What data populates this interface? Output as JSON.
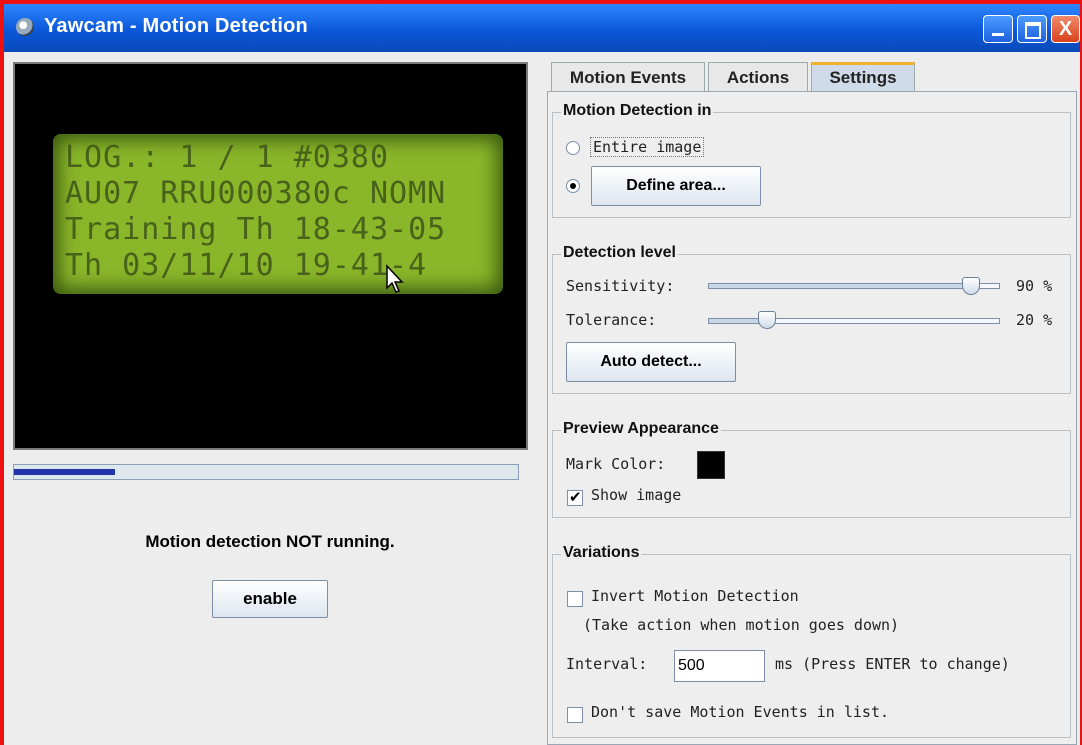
{
  "window": {
    "title": "Yawcam - Motion Detection",
    "close_glyph": "X"
  },
  "preview": {
    "lcd_lines": [
      "LOG.:   1 / 1    #0380",
      "AU07 RRU000380c NOMN",
      "Training Th 18-43-05",
      "Th 03/11/10 19-41-4"
    ]
  },
  "progress": {
    "value": 0.2
  },
  "left": {
    "status": "Motion detection NOT running.",
    "enable_label": "enable"
  },
  "tabs": [
    {
      "label": "Motion Events"
    },
    {
      "label": "Actions"
    },
    {
      "label": "Settings"
    }
  ],
  "settings": {
    "motion_detection_in": {
      "title": "Motion Detection in",
      "entire_image": "Entire image",
      "define_area": "Define area...",
      "selected": "define_area"
    },
    "detection_level": {
      "title": "Detection level",
      "sensitivity_label": "Sensitivity:",
      "sensitivity_value": 90,
      "sensitivity_text": "90 %",
      "tolerance_label": "Tolerance:",
      "tolerance_value": 20,
      "tolerance_text": "20 %",
      "auto_detect": "Auto detect..."
    },
    "preview_appearance": {
      "title": "Preview Appearance",
      "mark_color_label": "Mark Color:",
      "mark_color": "#000000",
      "show_image_label": "Show image",
      "show_image": true
    },
    "variations": {
      "title": "Variations",
      "invert_label": "Invert Motion Detection",
      "invert_checked": false,
      "invert_note": "(Take action when motion goes down)",
      "interval_label": "Interval:",
      "interval_value": "500",
      "interval_note": "ms (Press ENTER to change)",
      "dont_save_label": "Don't save Motion Events in list.",
      "dont_save_checked": false
    }
  },
  "colors": {
    "title_bar": "#0b58d9",
    "window_border": "#e11111",
    "lcd": "#8ab62a"
  }
}
